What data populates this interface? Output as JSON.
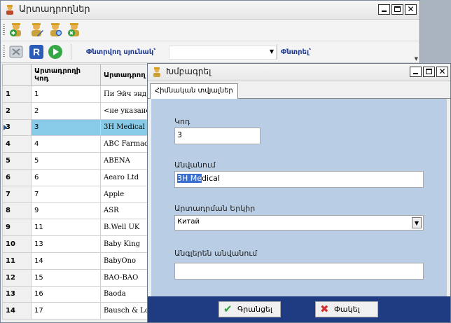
{
  "main_window": {
    "title": "Արտադրողներ",
    "filter_column_label": "Փնտրվող սյունակ՝",
    "filter_column_value": "",
    "search_label": "Փնտրել՝"
  },
  "grid": {
    "columns": [
      "Արտադրողի Կոդ",
      "Արտադրող"
    ],
    "rows": [
      {
        "rownum": "1",
        "code": "1",
        "name": "Пи Эйч энд Т"
      },
      {
        "rownum": "2",
        "code": "2",
        "name": "<не указано>"
      },
      {
        "rownum": "3",
        "code": "3",
        "name": "3H Medical"
      },
      {
        "rownum": "4",
        "code": "4",
        "name": "ABC Farmace"
      },
      {
        "rownum": "5",
        "code": "5",
        "name": "ABENA"
      },
      {
        "rownum": "6",
        "code": "6",
        "name": "Aearo Ltd"
      },
      {
        "rownum": "7",
        "code": "7",
        "name": "Apple"
      },
      {
        "rownum": "8",
        "code": "9",
        "name": "ASR"
      },
      {
        "rownum": "9",
        "code": "11",
        "name": "B.Well UK"
      },
      {
        "rownum": "10",
        "code": "13",
        "name": "Baby King"
      },
      {
        "rownum": "11",
        "code": "14",
        "name": "BabyOno"
      },
      {
        "rownum": "12",
        "code": "15",
        "name": "BAO-BAO"
      },
      {
        "rownum": "13",
        "code": "16",
        "name": "Baoda"
      },
      {
        "rownum": "14",
        "code": "17",
        "name": "Bausch & Lor"
      }
    ],
    "selected_row": "3",
    "selection_color": "#87cbe8"
  },
  "dialog": {
    "title": "Խմբագրել",
    "tab": "Հիմնական տվյալներ",
    "code_label": "Կոդ",
    "code_value": "3",
    "name_label": "Անվանում",
    "name_selected": "3H Me",
    "name_rest": "dical",
    "country_label": "Արտադրման Երկիր",
    "country_value": "Китай",
    "english_name_label": "Անգլերեն անվանում",
    "english_name_value": "",
    "ok_label": "Գրանցել",
    "cancel_label": "Փակել",
    "panel_color": "#b9cde4",
    "footer_color": "#1f3b82"
  }
}
